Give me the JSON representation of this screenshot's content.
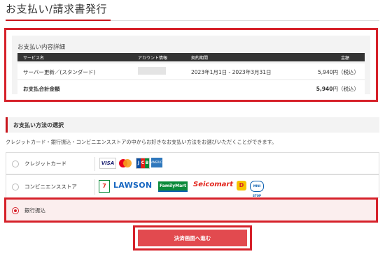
{
  "page": {
    "title": "お支払い/請求書発行"
  },
  "detail": {
    "heading": "お支払い内容詳細",
    "columns": [
      "サービス名",
      "アカウント情報",
      "契約期間",
      "金額"
    ],
    "rows": [
      {
        "service": "サーバー更新／(スタンダード)",
        "account": "",
        "period": "2023年1月1日 - 2023年3月31日",
        "amount_value": "5,940",
        "amount_unit": "円（税込）"
      }
    ],
    "total": {
      "label": "お支払合計金額",
      "value": "5,940",
      "unit": "円（税込）"
    }
  },
  "method": {
    "heading": "お支払い方法の選択",
    "description": "クレジットカード・銀行振込・コンビニエンスストアの中からお好きなお支払い方法をお選びいただくことができます。",
    "options": [
      {
        "label": "クレジットカード",
        "selected": false
      },
      {
        "label": "コンビニエンスストア",
        "selected": false
      },
      {
        "label": "銀行振込",
        "selected": true
      }
    ],
    "card_logos": {
      "visa": "VISA",
      "jcb": "JCB",
      "amex": "AMERICAN EXPRESS"
    },
    "store_logos": {
      "seven": "7",
      "lawson": "LAWSON",
      "famima": "FamilyMart",
      "seico": "Seicomart",
      "daily": "D",
      "ministop": "MINI STOP"
    }
  },
  "submit": {
    "label": "決済画面へ進む"
  },
  "colors": {
    "accent": "#d6212a",
    "button": "#e24a4f",
    "header_bg": "#333333"
  }
}
